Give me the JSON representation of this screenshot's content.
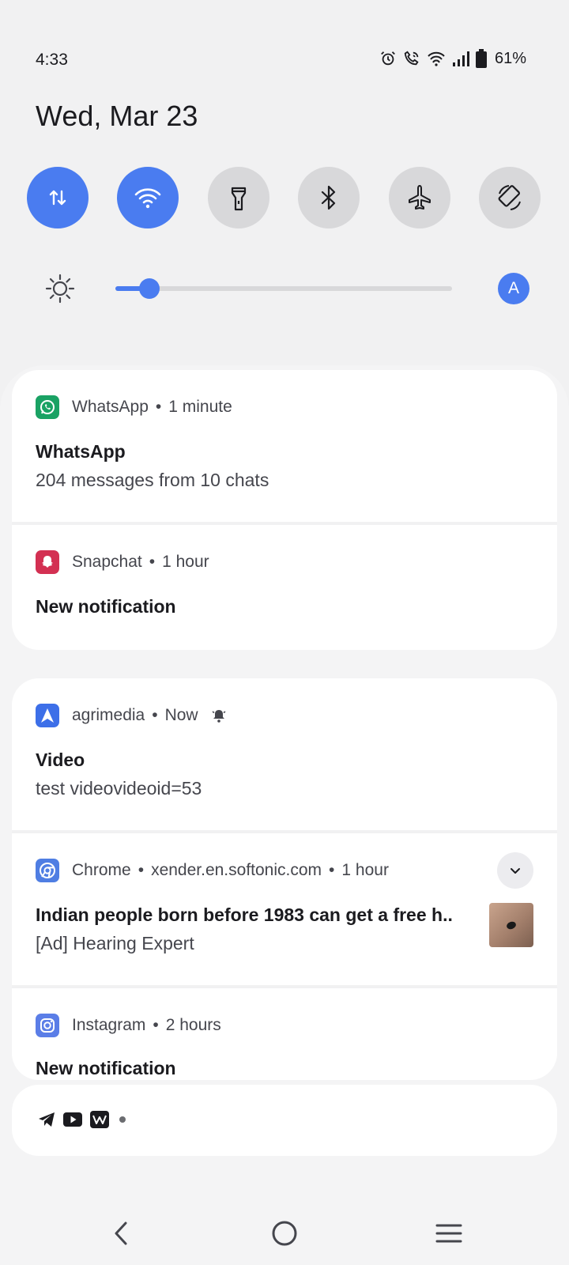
{
  "status_bar": {
    "time": "4:33",
    "battery_percent": "61%",
    "icons": [
      "alarm-icon",
      "wifi-calling-icon",
      "wifi-icon",
      "signal-icon",
      "battery-icon"
    ]
  },
  "date": "Wed, Mar 23",
  "quick_settings": [
    {
      "name": "mobile-data",
      "icon": "data-arrows-icon",
      "active": true
    },
    {
      "name": "wifi",
      "icon": "wifi-icon",
      "active": true
    },
    {
      "name": "flashlight",
      "icon": "flashlight-icon",
      "active": false
    },
    {
      "name": "bluetooth",
      "icon": "bluetooth-icon",
      "active": false
    },
    {
      "name": "airplane-mode",
      "icon": "airplane-icon",
      "active": false
    },
    {
      "name": "auto-rotate",
      "icon": "rotate-icon",
      "active": false
    }
  ],
  "brightness": {
    "level": 0.1,
    "auto_label": "A"
  },
  "notifications": {
    "whatsapp": {
      "app": "WhatsApp",
      "time": "1 minute",
      "title": "WhatsApp",
      "text": "204 messages from 10 chats"
    },
    "snapchat": {
      "app": "Snapchat",
      "time": "1 hour",
      "title": "New notification"
    },
    "agrimedia": {
      "app": "agrimedia",
      "time": "Now",
      "title": "Video",
      "text": "test videovideoid=53"
    },
    "chrome": {
      "app": "Chrome",
      "site": "xender.en.softonic.com",
      "time": "1 hour",
      "title": "Indian people born before 1983 can get a free h..",
      "text": "[Ad] Hearing Expert"
    },
    "instagram": {
      "app": "Instagram",
      "time": "2 hours",
      "title": "New notification"
    }
  },
  "silent_apps": [
    "telegram-icon",
    "youtube-icon",
    "app-icon"
  ],
  "separator": "•",
  "colors": {
    "accent": "#4a7cf0",
    "whatsapp": "#1aa264",
    "snapchat": "#d33052",
    "agrimedia": "#3d6fe8",
    "chrome": "#4f7ee3",
    "instagram": "#5b7ee7"
  }
}
